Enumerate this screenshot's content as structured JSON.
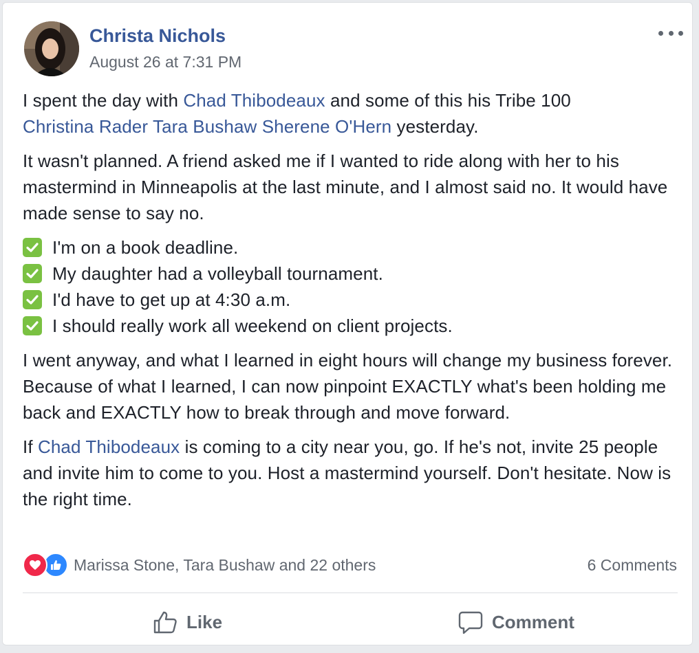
{
  "post": {
    "author": "Christa Nichols",
    "timestamp": "August 26 at 7:31 PM",
    "more_icon": "ellipsis-icon",
    "paragraph1": {
      "part1": "I spent the day with ",
      "mention1": "Chad Thibodeaux",
      "part2": " and some of this his Tribe 100 ",
      "mention2": "Christina Rader",
      "mention3": "Tara Bushaw",
      "mention4": "Sherene O'Hern",
      "part3": " yesterday."
    },
    "paragraph2": "It wasn't planned. A friend asked me if I wanted to ride along with her to his mastermind in Minneapolis at the last minute, and I almost said no. It would have made sense to say no.",
    "checklist": [
      "I'm on a book deadline.",
      "My daughter had a volleyball tournament.",
      "I'd have to get up at 4:30 a.m.",
      "I should really work all weekend on client projects."
    ],
    "paragraph3": "I went anyway, and what I learned in eight hours will change my business forever. Because of what I learned, I can now pinpoint EXACTLY what's been holding me back and EXACTLY how to break through and move forward.",
    "paragraph4": {
      "part1": "If ",
      "mention": "Chad Thibodeaux",
      "part2": " is coming to a city near you, go. If he's not, invite 25 people and invite him to come to you. Host a mastermind yourself. Don't hesitate. Now is the right time."
    }
  },
  "reactions": {
    "icons": [
      "heart-icon",
      "thumbs-up-icon"
    ],
    "names": "Marissa Stone, Tara Bushaw and 22 others",
    "comments": "6 Comments"
  },
  "actions": {
    "like_label": "Like",
    "comment_label": "Comment"
  },
  "colors": {
    "link": "#385898",
    "meta": "#616770",
    "check": "#7ac142",
    "heart": "#f0284a",
    "like": "#2d88ff"
  }
}
